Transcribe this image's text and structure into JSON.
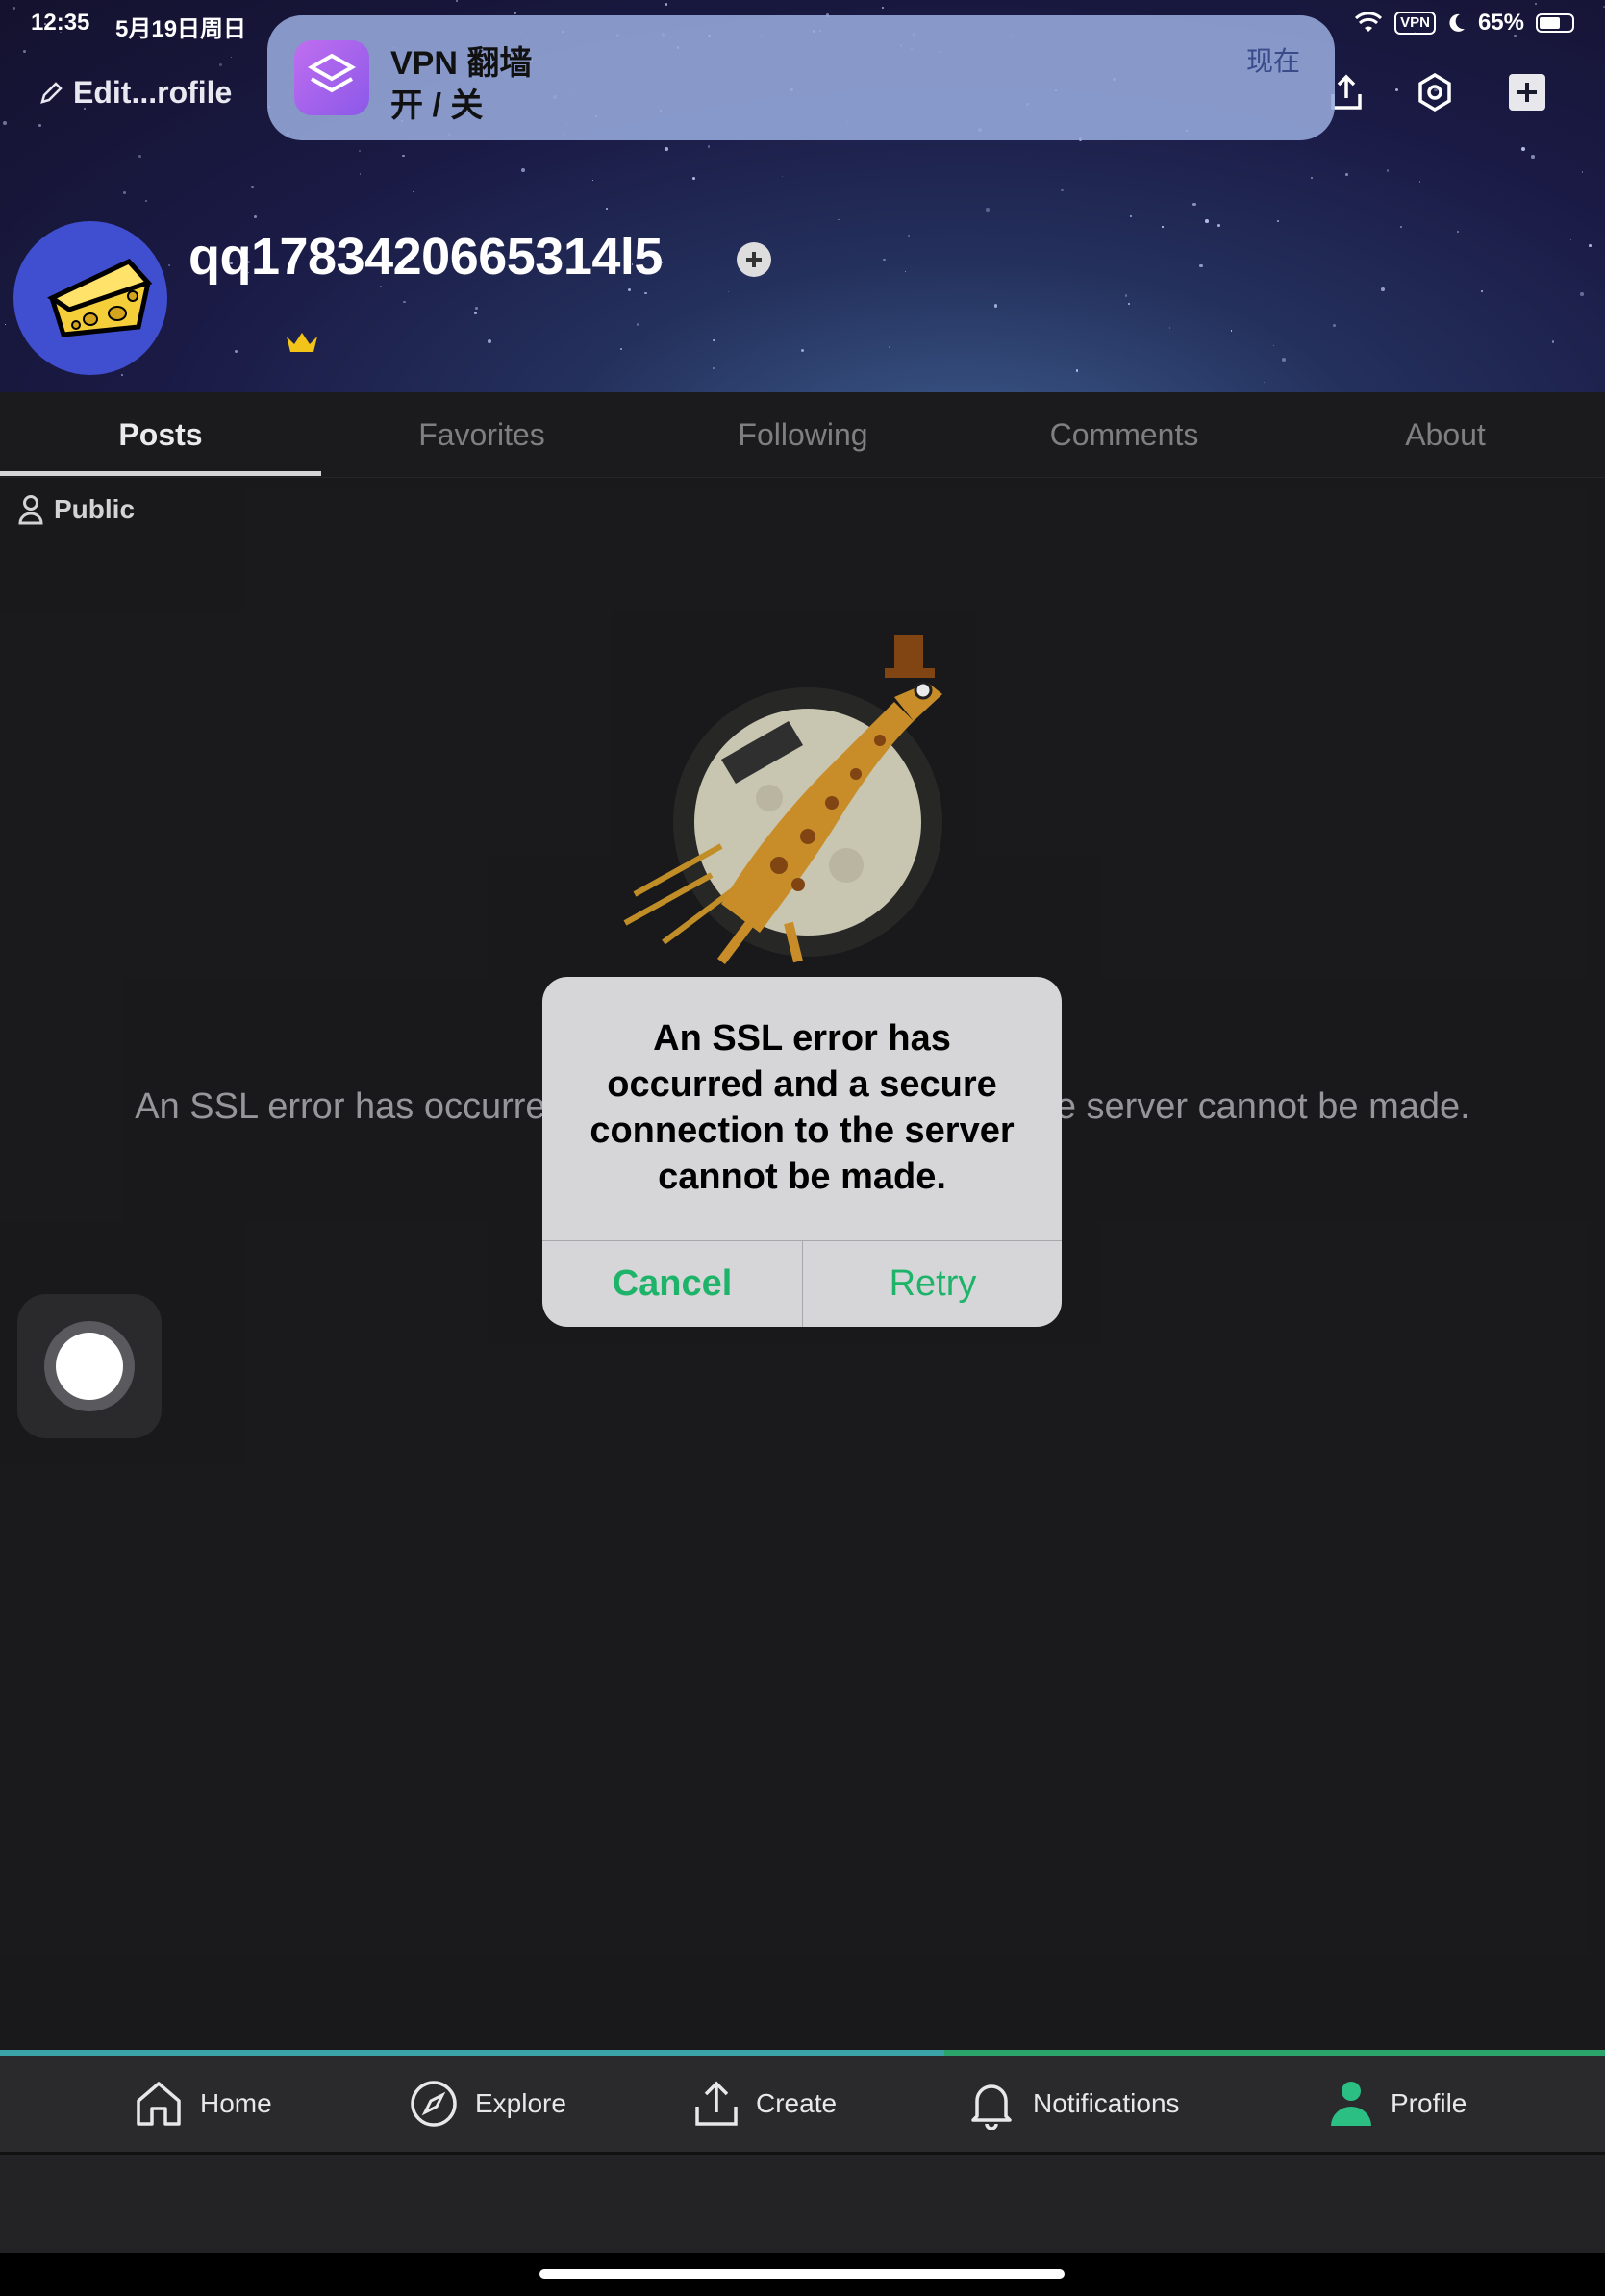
{
  "status_bar": {
    "time": "12:35",
    "date": "5月19日周日",
    "vpn": "VPN",
    "battery": "65%",
    "battery_level": 0.65
  },
  "banner": {
    "title": "VPN 翻墙",
    "body": "开 / 关",
    "time": "现在"
  },
  "header": {
    "edit_profile": "Edit...rofile",
    "username": "qq1783420665314l5"
  },
  "tabs": [
    {
      "label": "Posts",
      "active": true
    },
    {
      "label": "Favorites",
      "active": false
    },
    {
      "label": "Following",
      "active": false
    },
    {
      "label": "Comments",
      "active": false
    },
    {
      "label": "About",
      "active": false
    }
  ],
  "visibility": "Public",
  "error_text": "An SSL error has occurred and a secure connection to the server cannot be made.",
  "alert": {
    "message": "An SSL error has occurred and a secure connection to the server cannot be made.",
    "cancel": "Cancel",
    "retry": "Retry"
  },
  "nav": [
    {
      "label": "Home",
      "icon": "home-icon"
    },
    {
      "label": "Explore",
      "icon": "compass-icon"
    },
    {
      "label": "Create",
      "icon": "upload-icon"
    },
    {
      "label": "Notifications",
      "icon": "bell-icon"
    },
    {
      "label": "Profile",
      "icon": "person-icon"
    }
  ],
  "colors": {
    "accent_green": "#1db46a",
    "background": "#1c1c1e"
  }
}
